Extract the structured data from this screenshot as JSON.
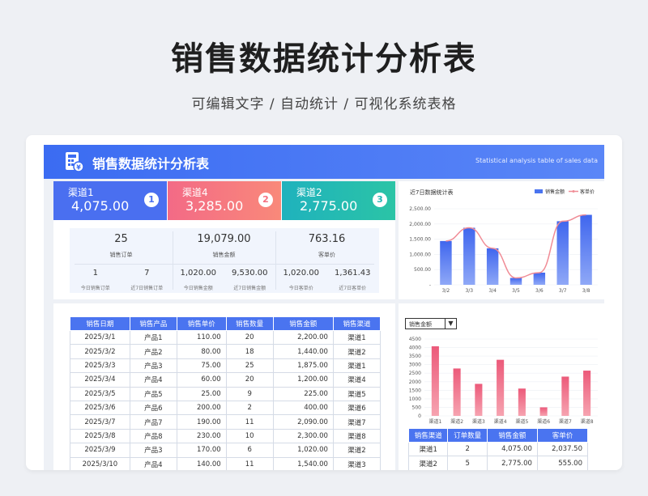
{
  "page": {
    "title": "销售数据统计分析表",
    "subtitle": "可编辑文字 / 自动统计 / 可视化系统表格"
  },
  "header": {
    "title": "销售数据统计分析表",
    "subtitle_en": "Statistical analysis table of sales data"
  },
  "kpi_cards": [
    {
      "label": "渠道1",
      "value": "4,075.00",
      "rank": "1",
      "color": "#4a6ff0"
    },
    {
      "label": "渠道4",
      "value": "3,285.00",
      "rank": "2",
      "color": "#f56f7f"
    },
    {
      "label": "渠道2",
      "value": "2,775.00",
      "rank": "3",
      "color": "#22b8b5"
    }
  ],
  "stats": [
    {
      "value": "25",
      "label": "销售订单",
      "today": "1",
      "today_label": "今日销售订单",
      "week": "7",
      "week_label": "近7日销售订单"
    },
    {
      "value": "19,079.00",
      "label": "销售金额",
      "today": "1,020.00",
      "today_label": "今日销售金额",
      "week": "9,530.00",
      "week_label": "近7日销售金额"
    },
    {
      "value": "763.16",
      "label": "客单价",
      "today": "1,020.00",
      "today_label": "今日客单价",
      "week": "1,361.43",
      "week_label": "近7日客单价"
    }
  ],
  "sales_table": {
    "headers": [
      "销售日期",
      "销售产品",
      "销售单价",
      "销售数量",
      "销售金额",
      "销售渠道"
    ],
    "rows": [
      [
        "2025/3/1",
        "产品1",
        "110.00",
        "20",
        "2,200.00",
        "渠道1"
      ],
      [
        "2025/3/2",
        "产品2",
        "80.00",
        "18",
        "1,440.00",
        "渠道2"
      ],
      [
        "2025/3/3",
        "产品3",
        "75.00",
        "25",
        "1,875.00",
        "渠道1"
      ],
      [
        "2025/3/4",
        "产品4",
        "60.00",
        "20",
        "1,200.00",
        "渠道4"
      ],
      [
        "2025/3/5",
        "产品5",
        "25.00",
        "9",
        "225.00",
        "渠道5"
      ],
      [
        "2025/3/6",
        "产品6",
        "200.00",
        "2",
        "400.00",
        "渠道6"
      ],
      [
        "2025/3/7",
        "产品7",
        "190.00",
        "11",
        "2,090.00",
        "渠道7"
      ],
      [
        "2025/3/8",
        "产品8",
        "230.00",
        "10",
        "2,300.00",
        "渠道8"
      ],
      [
        "2025/3/9",
        "产品3",
        "170.00",
        "6",
        "1,020.00",
        "渠道2"
      ],
      [
        "2025/3/10",
        "产品4",
        "140.00",
        "11",
        "1,540.00",
        "渠道3"
      ]
    ]
  },
  "channel_table": {
    "headers": [
      "销售渠道",
      "订单数量",
      "销售金额",
      "客单价"
    ],
    "rows": [
      [
        "渠道1",
        "2",
        "4,075.00",
        "2,037.50"
      ],
      [
        "渠道2",
        "5",
        "2,775.00",
        "555.00"
      ]
    ]
  },
  "dropdown": {
    "selected": "销售金额"
  },
  "chart_data": [
    {
      "type": "bar",
      "title": "近7日数据统计表",
      "categories": [
        "3/2",
        "3/3",
        "3/4",
        "3/5",
        "3/6",
        "3/7",
        "3/8"
      ],
      "series": [
        {
          "name": "销售金额",
          "type": "bar",
          "values": [
            1440,
            1875,
            1200,
            225,
            400,
            2090,
            2300
          ],
          "color": "#4a74f0"
        },
        {
          "name": "客单价",
          "type": "line",
          "values": [
            1440,
            1875,
            1200,
            225,
            400,
            2090,
            2300
          ],
          "color": "#f08c96"
        }
      ],
      "yticks": [
        "-",
        "500.00",
        "1,000.00",
        "1,500.00",
        "2,000.00",
        "2,500.00"
      ],
      "ylim": [
        0,
        2500
      ],
      "legend": "top-right",
      "grid": true
    },
    {
      "type": "bar",
      "categories": [
        "渠道1",
        "渠道2",
        "渠道3",
        "渠道4",
        "渠道5",
        "渠道6",
        "渠道7",
        "渠道8"
      ],
      "values": [
        4075,
        2775,
        1875,
        3285,
        1600,
        500,
        2300,
        2650
      ],
      "yticks": [
        "0",
        "500",
        "1000",
        "1500",
        "2000",
        "2500",
        "3000",
        "3500",
        "4000",
        "4500"
      ],
      "ylim": [
        0,
        4500
      ],
      "color": "#f06b86",
      "grid": true
    }
  ]
}
